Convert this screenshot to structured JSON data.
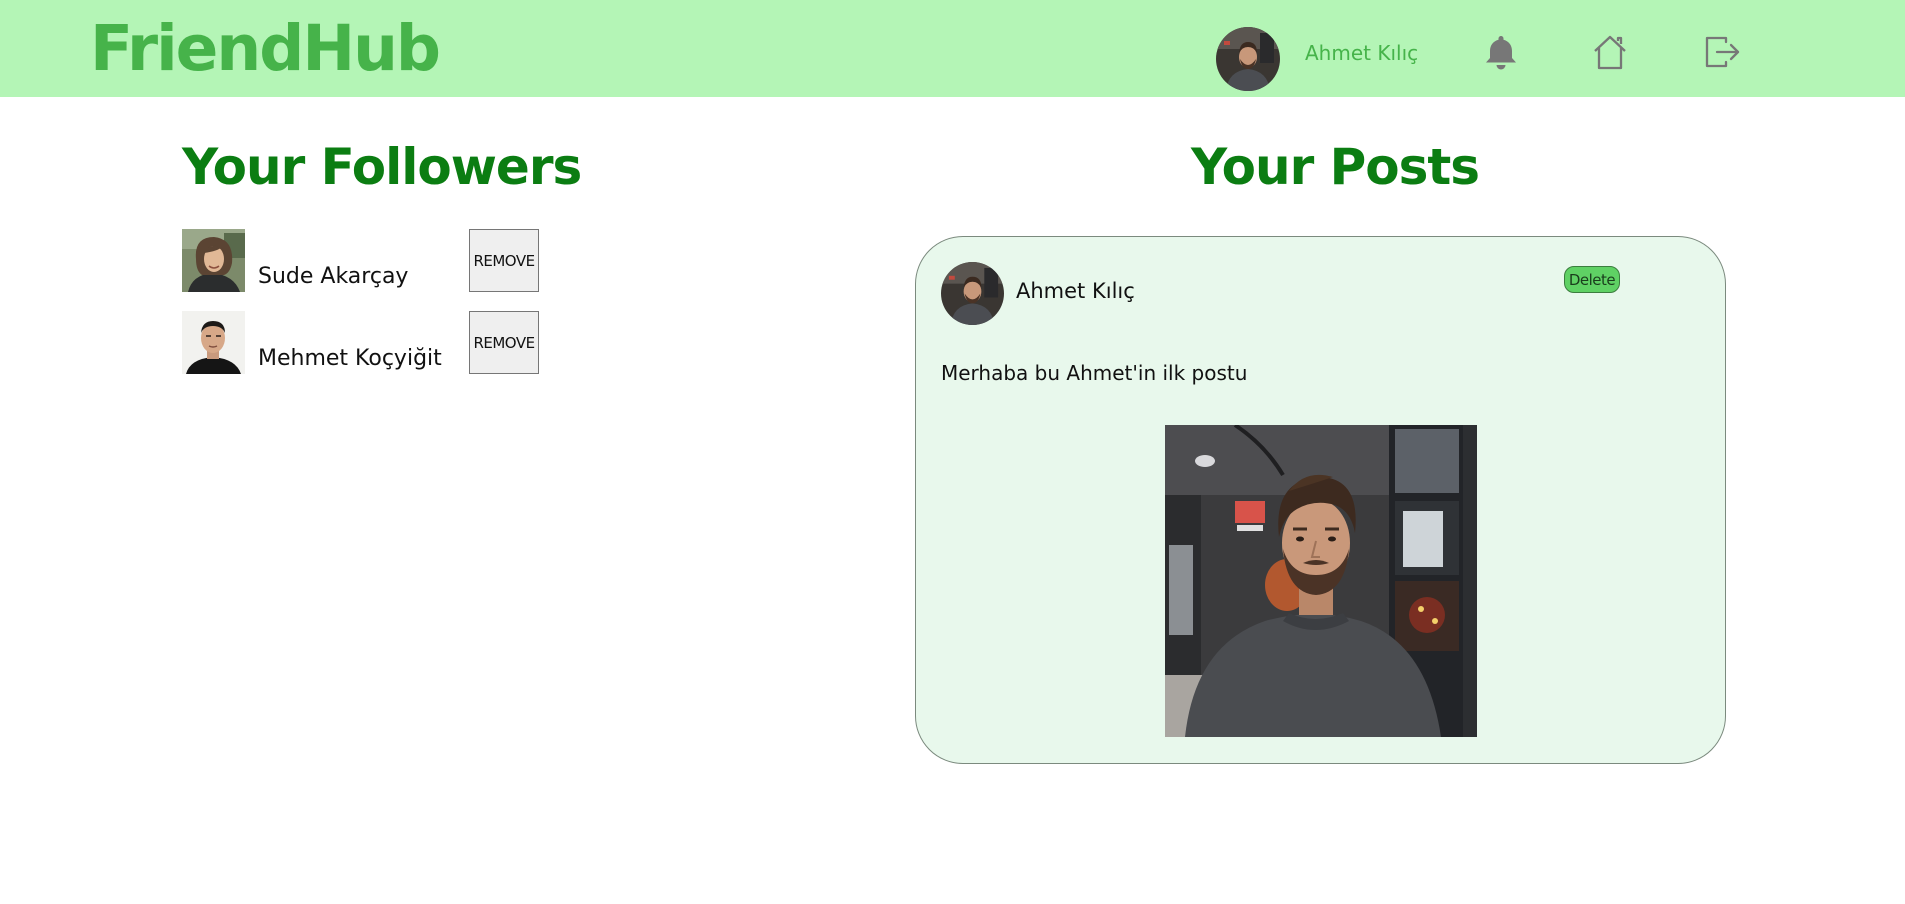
{
  "header": {
    "logo": "FriendHub",
    "user_name": "Ahmet Kılıç",
    "icons": [
      "bell-icon",
      "home-icon",
      "logout-icon"
    ],
    "background_color": "#b4f5b6",
    "accent_color": "#46b34a"
  },
  "followers": {
    "title": "Your Followers",
    "items": [
      {
        "name": "Sude Akarçay",
        "remove_label": "REMOVE"
      },
      {
        "name": "Mehmet Koçyiğit",
        "remove_label": "REMOVE"
      }
    ]
  },
  "posts": {
    "title": "Your Posts",
    "items": [
      {
        "author": "Ahmet Kılıç",
        "delete_label": "Delete",
        "text": "Merhaba bu Ahmet'in ilk postu"
      }
    ]
  },
  "colors": {
    "heading_green": "#0b7d12",
    "card_background": "#e8f8ec",
    "delete_button": "#5fd164"
  }
}
